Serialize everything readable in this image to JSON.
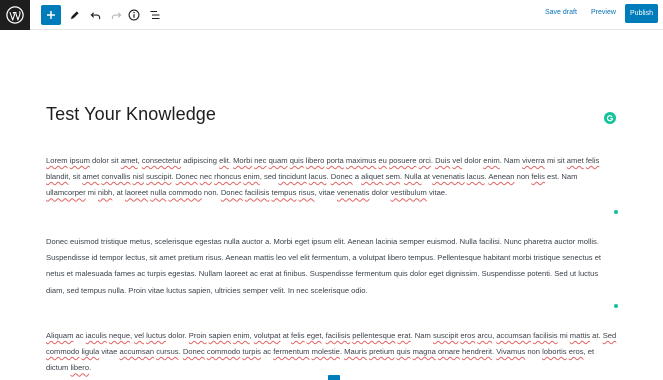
{
  "toolbar": {
    "save_draft": "Save draft",
    "preview": "Preview",
    "publish": "Publish",
    "icons": [
      "wordpress-logo",
      "plus-icon",
      "pencil-icon",
      "undo-icon",
      "redo-icon",
      "info-icon",
      "list-view-icon"
    ]
  },
  "post": {
    "title": "Test Your Knowledge",
    "paragraph1": [
      [
        "Lorem",
        true
      ],
      [
        " ",
        false
      ],
      [
        "ipsum",
        true
      ],
      [
        " dolor sit ",
        false
      ],
      [
        "amet",
        true
      ],
      [
        ", ",
        false
      ],
      [
        "consectetur",
        true
      ],
      [
        " adipiscing ",
        false
      ],
      [
        "elit",
        true
      ],
      [
        ". ",
        false
      ],
      [
        "Morbi",
        true
      ],
      [
        " ",
        false
      ],
      [
        "nec",
        true
      ],
      [
        " ",
        false
      ],
      [
        "quam",
        true
      ],
      [
        " ",
        false
      ],
      [
        "quis",
        true
      ],
      [
        " ",
        false
      ],
      [
        "libero",
        true
      ],
      [
        " ",
        false
      ],
      [
        "porta",
        true
      ],
      [
        " ",
        false
      ],
      [
        "maximus",
        true
      ],
      [
        " ",
        false
      ],
      [
        "eu",
        true
      ],
      [
        " ",
        false
      ],
      [
        "posuere",
        true
      ],
      [
        " ",
        false
      ],
      [
        "orci",
        true
      ],
      [
        ". ",
        false
      ],
      [
        "Duis",
        true
      ],
      [
        " ",
        false
      ],
      [
        "vel",
        true
      ],
      [
        " dolor ",
        false
      ],
      [
        "enim",
        true
      ],
      [
        ". Nam ",
        false
      ],
      [
        "viverra",
        true
      ],
      [
        " mi sit ",
        false
      ],
      [
        "amet",
        true
      ],
      [
        " ",
        false
      ],
      [
        "felis",
        true
      ],
      [
        " ",
        false
      ],
      [
        "blandit",
        true
      ],
      [
        ", sit ",
        false
      ],
      [
        "amet",
        true
      ],
      [
        " ",
        false
      ],
      [
        "convallis",
        true
      ],
      [
        " ",
        false
      ],
      [
        "nisl",
        true
      ],
      [
        " ",
        false
      ],
      [
        "suscipit",
        true
      ],
      [
        ". ",
        false
      ],
      [
        "Donec",
        true
      ],
      [
        " ",
        false
      ],
      [
        "nec",
        true
      ],
      [
        " ",
        false
      ],
      [
        "rhoncus",
        true
      ],
      [
        " ",
        false
      ],
      [
        "enim",
        true
      ],
      [
        ", sed ",
        false
      ],
      [
        "tincidunt",
        true
      ],
      [
        " ",
        false
      ],
      [
        "lacus",
        true
      ],
      [
        ". ",
        false
      ],
      [
        "Donec",
        true
      ],
      [
        " a ",
        false
      ],
      [
        "aliquet",
        true
      ],
      [
        " ",
        false
      ],
      [
        "sem",
        true
      ],
      [
        ". ",
        false
      ],
      [
        "Nulla",
        true
      ],
      [
        " at ",
        false
      ],
      [
        "venenatis",
        true
      ],
      [
        " ",
        false
      ],
      [
        "lacus",
        true
      ],
      [
        ". ",
        false
      ],
      [
        "Aenean",
        true
      ],
      [
        " non ",
        false
      ],
      [
        "felis",
        true
      ],
      [
        " est. Nam ",
        false
      ],
      [
        "ullamcorper",
        true
      ],
      [
        " mi ",
        false
      ],
      [
        "nibh",
        true
      ],
      [
        ", at ",
        false
      ],
      [
        "laoreet",
        true
      ],
      [
        " ",
        false
      ],
      [
        "nulla",
        true
      ],
      [
        " ",
        false
      ],
      [
        "commodo",
        true
      ],
      [
        " non. ",
        false
      ],
      [
        "Donec",
        true
      ],
      [
        " ",
        false
      ],
      [
        "facilisis",
        true
      ],
      [
        " ",
        false
      ],
      [
        "tempus",
        true
      ],
      [
        " ",
        false
      ],
      [
        "risus",
        true
      ],
      [
        ", vitae ",
        false
      ],
      [
        "venenatis",
        true
      ],
      [
        " dolor ",
        false
      ],
      [
        "vestibulum",
        true
      ],
      [
        " vitae.",
        false
      ]
    ],
    "paragraph2": "Donec euismod tristique metus, scelerisque egestas nulla auctor a. Morbi eget ipsum elit. Aenean lacinia semper euismod. Nulla facilisi. Nunc pharetra auctor mollis. Suspendisse id tempor lectus, sit amet pretium risus. Aenean mattis leo vel elit fermentum, a volutpat libero tempus. Pellentesque habitant morbi tristique senectus et netus et malesuada fames ac turpis egestas. Nullam laoreet ac erat at finibus. Suspendisse fermentum quis dolor eget dignissim. Suspendisse potenti. Sed ut luctus diam, sed tempus nulla. Proin vitae luctus sapien, ultricies semper velit. In nec scelerisque odio.",
    "paragraph3": [
      [
        "Aliquam",
        true
      ],
      [
        " ac ",
        false
      ],
      [
        "iaculis",
        true
      ],
      [
        " ",
        false
      ],
      [
        "neque",
        true
      ],
      [
        ", ",
        false
      ],
      [
        "vel",
        true
      ],
      [
        " ",
        false
      ],
      [
        "luctus",
        true
      ],
      [
        " dolor. ",
        false
      ],
      [
        "Proin",
        true
      ],
      [
        " ",
        false
      ],
      [
        "sapien",
        true
      ],
      [
        " ",
        false
      ],
      [
        "enim",
        true
      ],
      [
        ", ",
        false
      ],
      [
        "volutpat",
        true
      ],
      [
        " at ",
        false
      ],
      [
        "felis",
        true
      ],
      [
        " ",
        false
      ],
      [
        "eget",
        true
      ],
      [
        ", ",
        false
      ],
      [
        "facilisis",
        true
      ],
      [
        " ",
        false
      ],
      [
        "pellentesque",
        true
      ],
      [
        " ",
        false
      ],
      [
        "erat",
        true
      ],
      [
        ". Nam ",
        false
      ],
      [
        "suscipit",
        true
      ],
      [
        " ",
        false
      ],
      [
        "eros",
        true
      ],
      [
        " ",
        false
      ],
      [
        "arcu",
        true
      ],
      [
        ", ",
        false
      ],
      [
        "accumsan",
        true
      ],
      [
        " ",
        false
      ],
      [
        "facilisis",
        true
      ],
      [
        " mi ",
        false
      ],
      [
        "mattis",
        true
      ],
      [
        " at. ",
        false
      ],
      [
        "Sed",
        true
      ],
      [
        " ",
        false
      ],
      [
        "commodo",
        true
      ],
      [
        " ",
        false
      ],
      [
        "ligula",
        true
      ],
      [
        " vitae ",
        false
      ],
      [
        "accumsan",
        true
      ],
      [
        " ",
        false
      ],
      [
        "cursus",
        true
      ],
      [
        ". ",
        false
      ],
      [
        "Donec",
        true
      ],
      [
        " ",
        false
      ],
      [
        "commodo",
        true
      ],
      [
        " ",
        false
      ],
      [
        "turpis",
        true
      ],
      [
        " ac ",
        false
      ],
      [
        "fermentum",
        true
      ],
      [
        " ",
        false
      ],
      [
        "molestie",
        true
      ],
      [
        ". ",
        false
      ],
      [
        "Mauris",
        true
      ],
      [
        " ",
        false
      ],
      [
        "pretium",
        true
      ],
      [
        " ",
        false
      ],
      [
        "quis",
        true
      ],
      [
        " ",
        false
      ],
      [
        "magna",
        true
      ],
      [
        " ",
        false
      ],
      [
        "ornare",
        true
      ],
      [
        " ",
        false
      ],
      [
        "hendrerit",
        true
      ],
      [
        ". ",
        false
      ],
      [
        "Vivamus",
        true
      ],
      [
        " non ",
        false
      ],
      [
        "lobortis",
        true
      ],
      [
        " ",
        false
      ],
      [
        "eros",
        true
      ],
      [
        ", et dictum ",
        false
      ],
      [
        "libero",
        true
      ],
      [
        ".",
        false
      ]
    ]
  },
  "colors": {
    "accent": "#007cba",
    "grammarly": "#15c39a",
    "spellcheck": "#e26464"
  }
}
